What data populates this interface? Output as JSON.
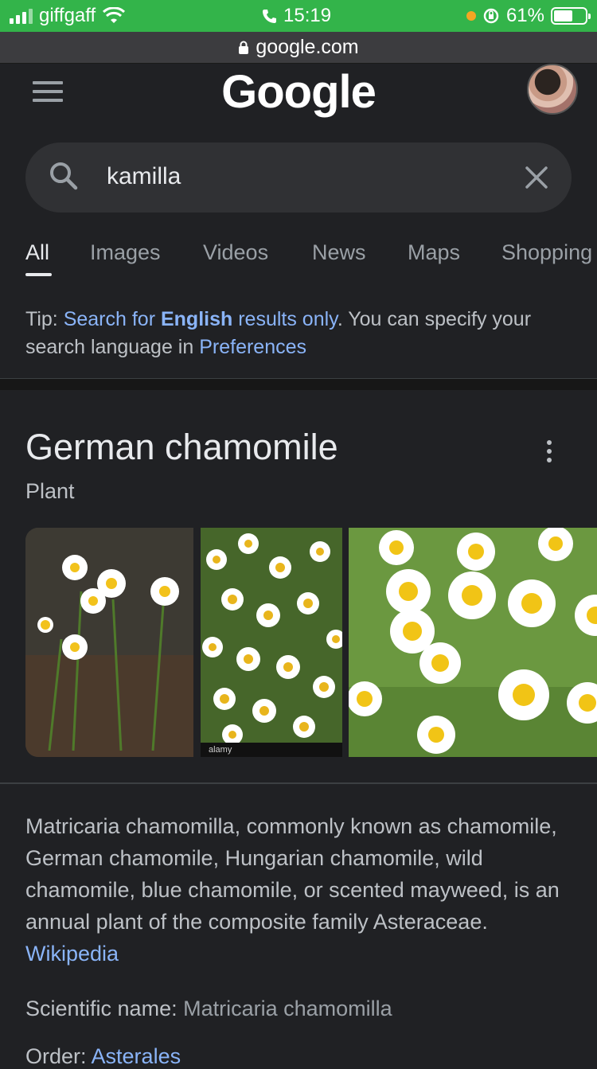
{
  "status_bar": {
    "carrier": "giffgaff",
    "time": "15:19",
    "battery": "61%",
    "battery_level": 0.61,
    "bg_color": "#33b44a"
  },
  "url_bar": {
    "domain": "google.com",
    "icon": "lock-icon"
  },
  "header": {
    "logo": "Google",
    "menu_icon": "hamburger-icon",
    "avatar_icon": "avatar"
  },
  "search": {
    "query": "kamilla",
    "search_icon": "search-icon",
    "clear_icon": "close-icon"
  },
  "tabs": [
    {
      "label": "All",
      "active": true
    },
    {
      "label": "Images",
      "active": false
    },
    {
      "label": "Videos",
      "active": false
    },
    {
      "label": "News",
      "active": false
    },
    {
      "label": "Maps",
      "active": false
    },
    {
      "label": "Shopping",
      "active": false
    }
  ],
  "tip": {
    "prefix": "Tip: ",
    "link1_a": "Search for ",
    "link1_bold": "English",
    "link1_b": " results only",
    "middle": ". You can specify your search language in ",
    "link2": "Preferences"
  },
  "knowledge_panel": {
    "title": "German chamomile",
    "subtitle": "Plant",
    "more_icon": "more-vert-icon",
    "images": [
      {
        "alt": "chamomile flowers with buds"
      },
      {
        "alt": "chamomile field",
        "watermark": "alamy"
      },
      {
        "alt": "chamomile flowers close-up"
      }
    ],
    "description": "Matricaria chamomilla, commonly known as chamomile, German chamomile, Hungarian chamomile, wild chamomile, blue chamomile, or scented mayweed, is an annual plant of the composite family Asteraceae. ",
    "description_link": "Wikipedia",
    "facts": [
      {
        "label": "Scientific name: ",
        "value": "Matricaria chamomilla"
      },
      {
        "label": "Order: ",
        "value": "Asterales"
      }
    ]
  },
  "colors": {
    "background": "#202124",
    "surface": "#303134",
    "link": "#8ab4f8",
    "text": "#e8eaed",
    "muted": "#9aa0a6"
  }
}
